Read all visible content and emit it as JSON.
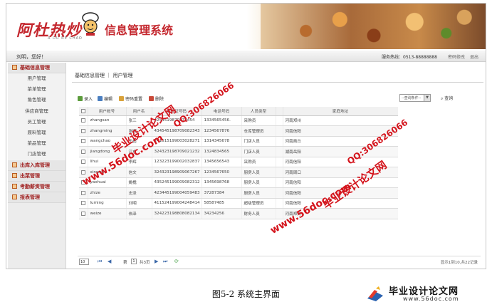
{
  "header": {
    "logo_text": "阿杜热炒",
    "logo_sub": "A DU RE CHAO",
    "system_title": "信息管理系统"
  },
  "userbar": {
    "greeting": "刘明，您好！",
    "hotline": "服务热线：0513-88888888",
    "change_password": "密码修改",
    "logout": "退出"
  },
  "sidebar": {
    "groups": [
      {
        "label": "基础信息管理",
        "items": [
          "用户管理",
          "菜单管理",
          "角色管理",
          "供应商管理",
          "员工管理",
          "原料管理",
          "菜品管理",
          "门店管理"
        ]
      },
      {
        "label": "出库入库管理"
      },
      {
        "label": "出菜管理"
      },
      {
        "label": "考勤薪资管理"
      },
      {
        "label": "报表管理"
      }
    ]
  },
  "breadcrumb": "基础信息管理 ｜ 用户管理",
  "toolbar": {
    "add": "录入",
    "edit": "编辑",
    "reset_password": "密码重置",
    "delete": "删除",
    "query_select": "--查询条件--",
    "query": "查询"
  },
  "table": {
    "headers": [
      "",
      "用户帐号",
      "用户名",
      "身份证号码",
      "电话号码",
      "人员类型",
      "",
      "家庭地址"
    ],
    "rows": [
      [
        "zhangsan",
        "张三",
        "4254519870873454",
        "1334565456.",
        "采购员",
        "河南郑州"
      ],
      [
        "zhangming",
        "张明",
        "434545198709082343",
        "1234567876",
        "仓库管理员",
        "河南信阳"
      ],
      [
        "wangchao",
        "王超",
        "241515199003028271",
        "1314345678",
        "门店人员",
        "河南商丘"
      ],
      [
        "jiangdong",
        "江东",
        "324323198709021232",
        "1324834565",
        "门店人员",
        "湖南岳阳"
      ],
      [
        "lihui",
        "李辉",
        "123223199002032837",
        "1345656543",
        "采购员",
        "河南信阳"
      ],
      [
        "xinwen",
        "信文",
        "324323198909067267",
        "1234567650",
        "厨房人员",
        "河南周口"
      ],
      [
        "yaohuai",
        "姚槐",
        "435245199009082312",
        "1345698768",
        "厨房人员",
        "河南信阳"
      ],
      [
        "zhize",
        "志泽",
        "423445199004059483",
        "37287384",
        "厨房人员",
        "河南信阳"
      ],
      [
        "luming",
        "刘明",
        "411524199004248414",
        "58587485",
        "超级管理员",
        "河南信阳"
      ],
      [
        "weize",
        "伟泽",
        "324223198808082134",
        "34234256",
        "财务人员",
        "河南郑州"
      ]
    ]
  },
  "pager": {
    "page_size": "10",
    "page_label": "第",
    "current_page": "1",
    "total_pages": "共3页",
    "info": "显示1到10,共22记录"
  },
  "watermarks": {
    "site_cn": "毕业设计论文网",
    "url": "www.56doc.com",
    "qq": "QQ:306826066"
  },
  "caption": "图5-2  系统主界面",
  "brand": {
    "name": "毕业设计论文网",
    "url": "www.56doc.com"
  },
  "colors": {
    "brand_red": "#c4272e",
    "watermark_red": "#d4141c",
    "sidebar_group": "#a02020"
  }
}
